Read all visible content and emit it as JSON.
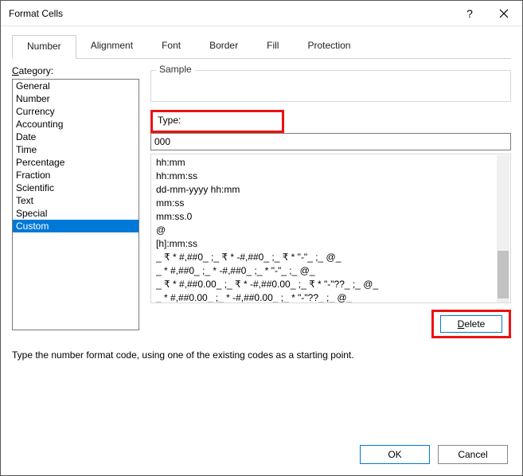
{
  "titlebar": {
    "title": "Format Cells"
  },
  "tabs": {
    "number": "Number",
    "alignment": "Alignment",
    "font": "Font",
    "border": "Border",
    "fill": "Fill",
    "protection": "Protection"
  },
  "category_label": "Category:",
  "categories": {
    "general": "General",
    "number": "Number",
    "currency": "Currency",
    "accounting": "Accounting",
    "date": "Date",
    "time": "Time",
    "percentage": "Percentage",
    "fraction": "Fraction",
    "scientific": "Scientific",
    "text": "Text",
    "special": "Special",
    "custom": "Custom"
  },
  "sample_label": "Sample",
  "type_label": "Type:",
  "type_value": "000",
  "format_codes": {
    "c0": "hh:mm",
    "c1": "hh:mm:ss",
    "c2": "dd-mm-yyyy hh:mm",
    "c3": "mm:ss",
    "c4": "mm:ss.0",
    "c5": "@",
    "c6": "[h]:mm:ss",
    "c7": "_ ₹ * #,##0_ ;_ ₹ * -#,##0_ ;_ ₹ * \"-\"_ ;_ @_",
    "c8": "_ * #,##0_ ;_ * -#,##0_ ;_ * \"-\"_ ;_ @_",
    "c9": "_ ₹ * #,##0.00_ ;_ ₹ * -#,##0.00_ ;_ ₹ * \"-\"??_ ;_ @_",
    "c10": "_ * #,##0.00_ ;_ * -#,##0.00_ ;_ * \"-\"??_ ;_ @_"
  },
  "delete_btn": "Delete",
  "help_text": "Type the number format code, using one of the existing codes as a starting point.",
  "footer": {
    "ok": "OK",
    "cancel": "Cancel"
  }
}
